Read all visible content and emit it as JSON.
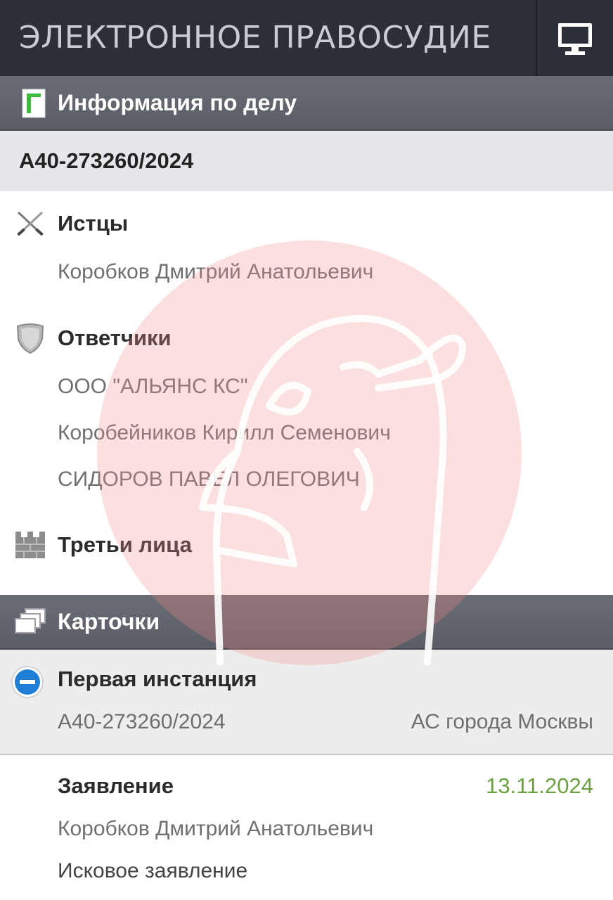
{
  "app": {
    "brand": "ЭЛЕКТРОННОЕ ПРАВОСУДИЕ",
    "monitor_icon": "monitor-icon"
  },
  "case_info": {
    "header_title": "Информация по делу",
    "header_icon": "document-icon",
    "case_number": "А40-273260/2024"
  },
  "plaintiffs": {
    "title": "Истцы",
    "icon": "crossed-swords-icon",
    "items": [
      "Коробков Дмитрий Анатольевич"
    ]
  },
  "defendants": {
    "title": "Ответчики",
    "icon": "shield-icon",
    "items": [
      "ООО \"АЛЬЯНС КС\"",
      "Коробейников Кирилл Семенович",
      "СИДОРОВ ПАВЕЛ ОЛЕГОВИЧ"
    ]
  },
  "third_parties": {
    "title": "Третьи лица",
    "icon": "wall-icon"
  },
  "cards": {
    "header_title": "Карточки",
    "header_icon": "cards-stack-icon"
  },
  "first_instance": {
    "title": "Первая инстанция",
    "icon": "collapse-minus-icon",
    "case_number": "А40-273260/2024",
    "court": "АС города Москвы"
  },
  "document": {
    "type": "Заявление",
    "date": "13.11.2024",
    "author": "Коробков Дмитрий Анатольевич",
    "description": "Исковое заявление"
  },
  "colors": {
    "topbar": "#2c2f38",
    "section_header": "#5f626a",
    "date_green": "#6aa13e",
    "watermark": "#f4a6a6"
  }
}
